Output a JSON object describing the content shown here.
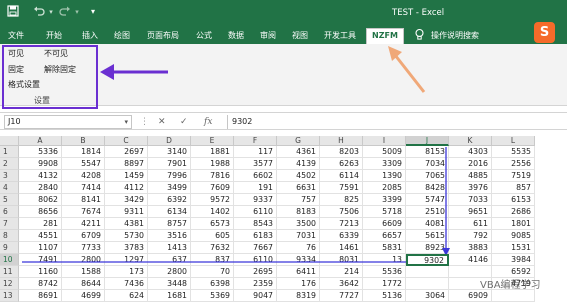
{
  "window": {
    "title": "TEST  -  Excel"
  },
  "qat": {
    "save_icon": "save-icon",
    "undo_icon": "undo-icon",
    "redo_icon": "redo-icon",
    "customize_icon": "chevron-down-icon"
  },
  "tabs": [
    {
      "label": "文件"
    },
    {
      "label": "开始"
    },
    {
      "label": "插入"
    },
    {
      "label": "绘图"
    },
    {
      "label": "页面布局"
    },
    {
      "label": "公式"
    },
    {
      "label": "数据"
    },
    {
      "label": "审阅"
    },
    {
      "label": "视图"
    },
    {
      "label": "开发工具"
    },
    {
      "label": "NZFM",
      "active": true
    },
    {
      "label": "操作说明搜索"
    }
  ],
  "ribbon": {
    "visible": "可见",
    "invisible": "不可见",
    "freeze": "固定",
    "unfreeze": "解除固定",
    "format_settings": "格式设置",
    "group_label": "设置"
  },
  "formula_bar": {
    "name_box": "J10",
    "cancel": "✕",
    "enter": "✓",
    "fx": "fx",
    "value": "9302"
  },
  "sheet": {
    "columns": [
      "A",
      "B",
      "C",
      "D",
      "E",
      "F",
      "G",
      "H",
      "I",
      "J",
      "K",
      "L"
    ],
    "selected_col": "J",
    "active_cell": "J10",
    "rows": [
      {
        "n": "1",
        "cells": [
          "5336",
          "1814",
          "2697",
          "3140",
          "1881",
          "117",
          "4361",
          "8203",
          "5009",
          "8153",
          "4303",
          "5535"
        ]
      },
      {
        "n": "2",
        "cells": [
          "9908",
          "5547",
          "8897",
          "7901",
          "1988",
          "3577",
          "4139",
          "6263",
          "3309",
          "7034",
          "2016",
          "2556"
        ]
      },
      {
        "n": "3",
        "cells": [
          "4132",
          "4208",
          "1459",
          "7996",
          "7816",
          "6602",
          "4502",
          "6114",
          "1390",
          "7065",
          "4885",
          "7519"
        ]
      },
      {
        "n": "4",
        "cells": [
          "2840",
          "7414",
          "4112",
          "3499",
          "7609",
          "191",
          "6631",
          "7591",
          "2085",
          "8428",
          "3976",
          "857"
        ]
      },
      {
        "n": "5",
        "cells": [
          "8062",
          "8141",
          "3429",
          "6392",
          "9572",
          "9337",
          "757",
          "825",
          "3399",
          "5747",
          "7033",
          "6153"
        ]
      },
      {
        "n": "6",
        "cells": [
          "8656",
          "7674",
          "9311",
          "6134",
          "1402",
          "6110",
          "8183",
          "7506",
          "5718",
          "2510",
          "9651",
          "2686"
        ]
      },
      {
        "n": "7",
        "cells": [
          "281",
          "4211",
          "4381",
          "8757",
          "6573",
          "8543",
          "3500",
          "7213",
          "6609",
          "4081",
          "611",
          "1801"
        ]
      },
      {
        "n": "8",
        "cells": [
          "4551",
          "6709",
          "5730",
          "3516",
          "605",
          "6183",
          "7031",
          "6339",
          "6657",
          "5615",
          "792",
          "9085"
        ]
      },
      {
        "n": "9",
        "cells": [
          "1107",
          "7733",
          "3783",
          "1413",
          "7632",
          "7667",
          "76",
          "1461",
          "5831",
          "8923",
          "3883",
          "1531"
        ]
      },
      {
        "n": "10",
        "cells": [
          "7491",
          "2800",
          "1297",
          "637",
          "837",
          "6110",
          "9334",
          "8031",
          "13",
          "9302",
          "4146",
          "3984"
        ]
      },
      {
        "n": "11",
        "cells": [
          "1160",
          "1588",
          "173",
          "2800",
          "70",
          "2695",
          "6411",
          "214",
          "5536",
          "",
          "",
          "6592"
        ]
      },
      {
        "n": "12",
        "cells": [
          "8742",
          "8644",
          "7436",
          "3448",
          "6398",
          "2359",
          "176",
          "3642",
          "1772",
          "",
          "",
          "4719"
        ]
      },
      {
        "n": "13",
        "cells": [
          "8691",
          "4699",
          "624",
          "1681",
          "5369",
          "9047",
          "8319",
          "7727",
          "5136",
          "3064",
          "6909",
          ""
        ]
      }
    ]
  },
  "watermark": {
    "text": "VBA编程学习"
  },
  "colors": {
    "excel_green": "#217346",
    "annotation_purple": "#6a2fd1",
    "annotation_orange": "#f0a878",
    "guide_blue": "#3b36d9"
  }
}
